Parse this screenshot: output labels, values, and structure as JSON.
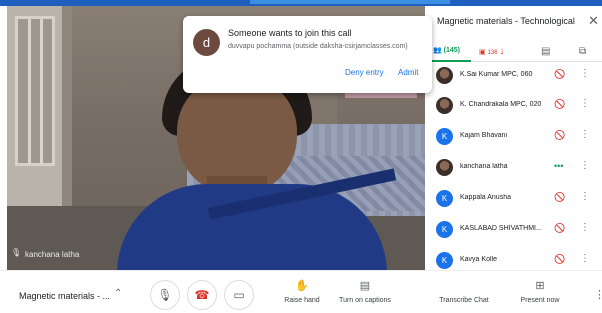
{
  "video": {
    "participant_name": "kanchana latha",
    "mic_icon": "mic-off-icon"
  },
  "panel": {
    "title": "Magnetic materials - Technological a...",
    "close_icon": "close-icon",
    "tabs": {
      "people_count": "(145)",
      "chat_count": "136"
    },
    "participants": [
      {
        "initial": "",
        "name": "K.Sai Kumar MPC, 060",
        "avatar": "photo",
        "mic": "mic-off-icon"
      },
      {
        "initial": "",
        "name": "K. Chandrakala MPC, 020",
        "avatar": "photo",
        "mic": "mic-off-icon"
      },
      {
        "initial": "K",
        "name": "Kajam Bhavani",
        "avatar": "letter",
        "mic": "mic-off-icon"
      },
      {
        "initial": "",
        "name": "kanchana latha",
        "avatar": "photo",
        "mic": "speaking-icon"
      },
      {
        "initial": "K",
        "name": "Kappala Anusha",
        "avatar": "letter",
        "mic": "mic-off-icon"
      },
      {
        "initial": "K",
        "name": "KASLABAD SHIVATHMI...",
        "avatar": "letter",
        "mic": "mic-off-icon"
      },
      {
        "initial": "K",
        "name": "Kavya Kolle",
        "avatar": "letter",
        "mic": "mic-off-icon"
      }
    ]
  },
  "dialog": {
    "avatar_initial": "d",
    "title": "Someone wants to join this call",
    "subtitle": "duvvapu pochamma (outside daksha-csirjamclasses.com)",
    "deny_label": "Deny entry",
    "admit_label": "Admit"
  },
  "bottombar": {
    "meeting_title": "Magnetic materials - ...",
    "actions": {
      "raise_hand": "Raise hand",
      "captions": "Turn on captions",
      "transcribe": "Transcribe Chat",
      "present": "Present now"
    }
  },
  "colors": {
    "accent_blue": "#1a73e8",
    "hangup_red": "#d93025",
    "people_green": "#0f9d58"
  }
}
